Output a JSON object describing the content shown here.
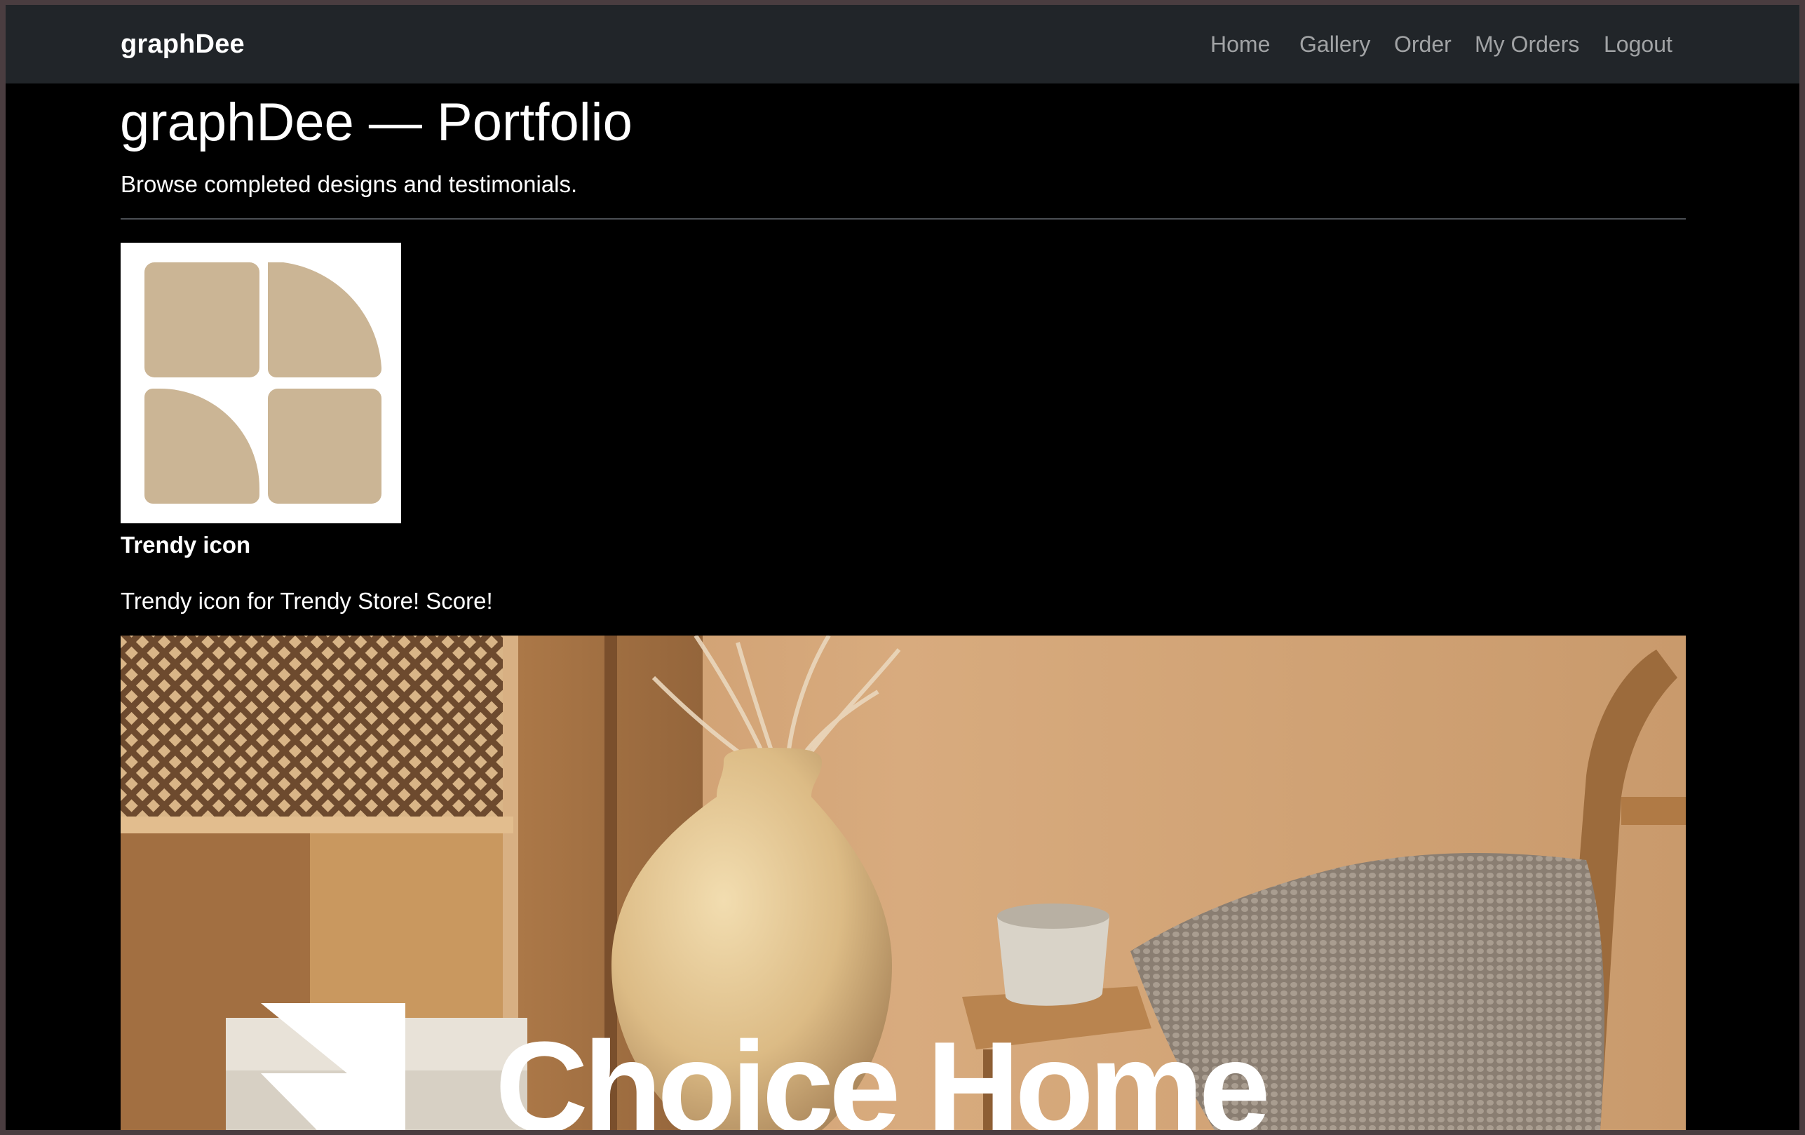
{
  "navbar": {
    "brand": "graphDee",
    "links": [
      {
        "label": "Home"
      },
      {
        "label": "Gallery"
      },
      {
        "label": "Order"
      },
      {
        "label": "My Orders"
      },
      {
        "label": "Logout"
      }
    ]
  },
  "page": {
    "title": "graphDee — Portfolio",
    "subtitle": "Browse completed designs and testimonials."
  },
  "portfolio": {
    "items": [
      {
        "title": "Trendy icon",
        "description": "Trendy icon for Trendy Store! Score!",
        "image_icon": "four-rounded-tiles-logo"
      }
    ],
    "banner": {
      "text": "Choice Home",
      "image_icon": "choice-home-interior-banner"
    }
  },
  "colors": {
    "navbar_bg": "#212529",
    "page_bg": "#000000",
    "tile_color": "#cbb595",
    "nav_link": "rgba(255,255,255,0.58)"
  }
}
